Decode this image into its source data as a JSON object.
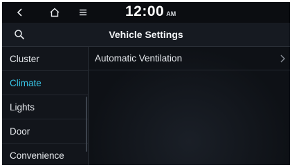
{
  "status_bar": {
    "time": "12:00",
    "ampm": "AM",
    "icons": [
      "back-icon",
      "home-icon",
      "menu-icon"
    ]
  },
  "header": {
    "title": "Vehicle Settings",
    "search_icon": "search-icon"
  },
  "sidebar": {
    "items": [
      {
        "label": "Cluster",
        "active": false
      },
      {
        "label": "Climate",
        "active": true
      },
      {
        "label": "Lights",
        "active": false
      },
      {
        "label": "Door",
        "active": false
      },
      {
        "label": "Convenience",
        "active": false
      }
    ]
  },
  "content": {
    "rows": [
      {
        "label": "Automatic Ventilation",
        "icon": "chevron-right-icon"
      }
    ]
  },
  "colors": {
    "accent": "#38c4e6",
    "background": "#0e1116",
    "text": "#e4e7eb"
  }
}
